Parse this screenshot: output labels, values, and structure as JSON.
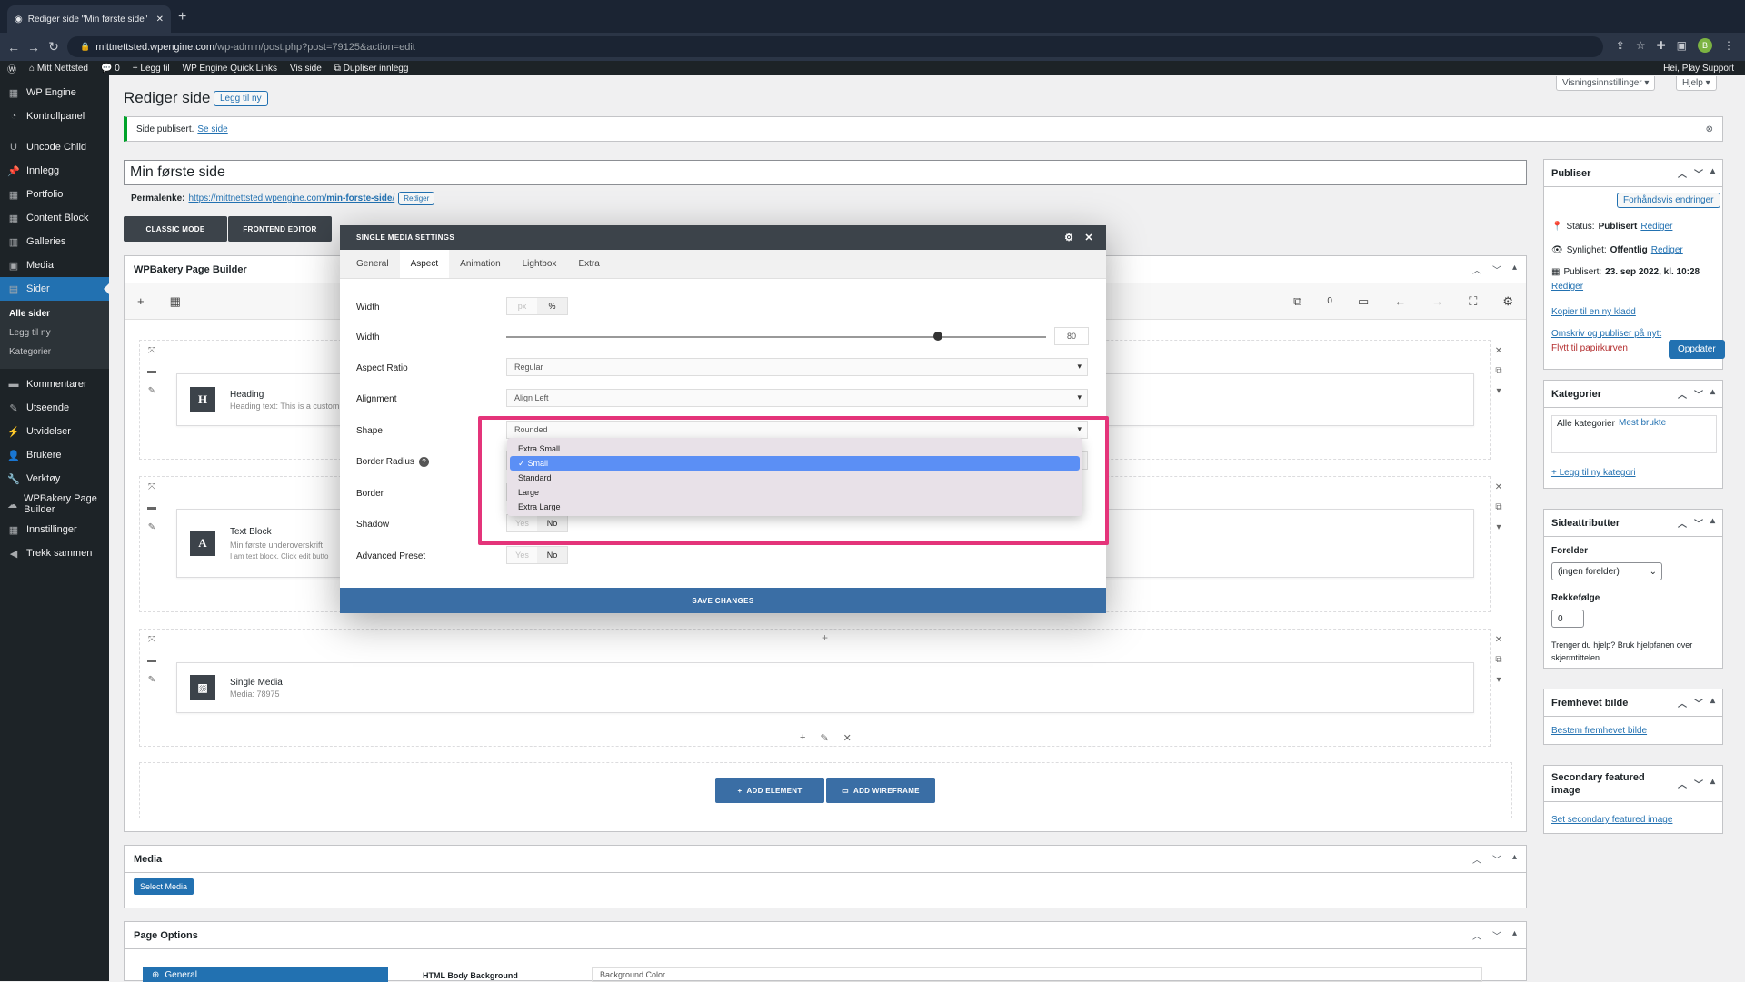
{
  "browser": {
    "tab_title": "Rediger side \"Min første side\"",
    "url_host": "mittnettsted.wpengine.com",
    "url_path": "/wp-admin/post.php?post=79125&action=edit",
    "avatar_letter": "B"
  },
  "adminbar": {
    "site": "Mitt Nettsted",
    "comments": "0",
    "new": "Legg til",
    "quicklinks": "WP Engine Quick Links",
    "view": "Vis side",
    "duplicate": "Dupliser innlegg",
    "greeting": "Hei, Play Support"
  },
  "sidebar": {
    "items": [
      {
        "label": "WP Engine",
        "icon": "wpengine-icon"
      },
      {
        "label": "Kontrollpanel",
        "icon": "dashboard-icon"
      },
      {
        "label": "Uncode Child",
        "icon": "theme-icon"
      },
      {
        "label": "Innlegg",
        "icon": "pin-icon"
      },
      {
        "label": "Portfolio",
        "icon": "grid-icon"
      },
      {
        "label": "Content Block",
        "icon": "grid-icon"
      },
      {
        "label": "Galleries",
        "icon": "gallery-icon"
      },
      {
        "label": "Media",
        "icon": "media-icon"
      },
      {
        "label": "Sider",
        "icon": "pages-icon"
      }
    ],
    "sub": [
      "Alle sider",
      "Legg til ny",
      "Kategorier"
    ],
    "items2": [
      {
        "label": "Kommentarer",
        "icon": "comment-icon"
      },
      {
        "label": "Utseende",
        "icon": "brush-icon"
      },
      {
        "label": "Utvidelser",
        "icon": "plugin-icon"
      },
      {
        "label": "Brukere",
        "icon": "users-icon"
      },
      {
        "label": "Verktøy",
        "icon": "wrench-icon"
      },
      {
        "label": "WPBakery Page Builder",
        "icon": "cloud-icon"
      },
      {
        "label": "Innstillinger",
        "icon": "settings-icon"
      },
      {
        "label": "Trekk sammen",
        "icon": "collapse-icon"
      }
    ]
  },
  "screen_options": "Visningsinnstillinger ▾",
  "help": "Hjelp ▾",
  "page_heading": "Rediger side",
  "add_new": "Legg til ny",
  "notice": {
    "text": "Side publisert.",
    "link": "Se side"
  },
  "title_value": "Min første side",
  "permalink": {
    "label": "Permalenke:",
    "url_base": "https://mittnettsted.wpengine.com/",
    "url_slug": "min-forste-side",
    "url_end": "/",
    "edit": "Rediger"
  },
  "mode_buttons": {
    "classic": "CLASSIC MODE",
    "frontend": "FRONTEND EDITOR"
  },
  "builder": {
    "title": "WPBakery Page Builder",
    "count": "0",
    "elements": [
      {
        "name": "Heading",
        "icon": "H",
        "desc": "Heading text: This is a custom"
      },
      {
        "name": "Text Block",
        "icon": "A",
        "desc": "Min første underoverskrift",
        "desc2": "I am text block. Click edit butto"
      },
      {
        "name": "Single Media",
        "icon": "image",
        "desc": "Media: 78975"
      }
    ],
    "add_element": "ADD ELEMENT",
    "add_wireframe": "ADD WIREFRAME"
  },
  "modal": {
    "title": "SINGLE MEDIA SETTINGS",
    "tabs": [
      "General",
      "Aspect",
      "Animation",
      "Lightbox",
      "Extra"
    ],
    "active_tab": "Aspect",
    "fields": {
      "width_unit_label": "Width",
      "unit_px": "px",
      "unit_pct": "%",
      "width_label": "Width",
      "width_value": "80",
      "width_fraction": 0.8,
      "aspect_label": "Aspect Ratio",
      "aspect_value": "Regular",
      "align_label": "Alignment",
      "align_value": "Align Left",
      "shape_label": "Shape",
      "shape_value": "Rounded",
      "radius_label": "Border Radius",
      "border_label": "Border",
      "shadow_label": "Shadow",
      "preset_label": "Advanced Preset",
      "yes": "Yes",
      "no": "No"
    },
    "dropdown_options": [
      "Extra Small",
      "Small",
      "Standard",
      "Large",
      "Extra Large"
    ],
    "dropdown_selected": "Small",
    "save": "SAVE CHANGES"
  },
  "media_box": {
    "title": "Media",
    "button": "Select Media"
  },
  "page_options": {
    "title": "Page Options",
    "tab": "General",
    "field": "HTML Body Background",
    "value": "Background Color"
  },
  "publish": {
    "title": "Publiser",
    "preview": "Forhåndsvis endringer",
    "status_label": "Status:",
    "status_value": "Publisert",
    "visibility_label": "Synlighet:",
    "visibility_value": "Offentlig",
    "published_label": "Publisert:",
    "published_value": "23. sep 2022, kl. 10:28",
    "edit": "Rediger",
    "copy_draft": "Kopier til en ny kladd",
    "rewrite": "Omskriv og publiser på nytt",
    "trash": "Flytt til papirkurven",
    "update": "Oppdater"
  },
  "categories": {
    "title": "Kategorier",
    "tab_all": "Alle kategorier",
    "tab_used": "Mest brukte",
    "add": "+ Legg til ny kategori"
  },
  "attributes": {
    "title": "Sideattributter",
    "parent_label": "Forelder",
    "parent_value": "(ingen forelder)",
    "order_label": "Rekkefølge",
    "order_value": "0",
    "help": "Trenger du hjelp? Bruk hjelpfanen over skjermtittelen."
  },
  "featured": {
    "title": "Fremhevet bilde",
    "link": "Bestem fremhevet bilde"
  },
  "secondary": {
    "title": "Secondary featured image",
    "link": "Set secondary featured image"
  },
  "colors": {
    "wp_blue": "#2271b1",
    "highlight": "#e4347a",
    "vc_blue": "#3a6ea5"
  }
}
